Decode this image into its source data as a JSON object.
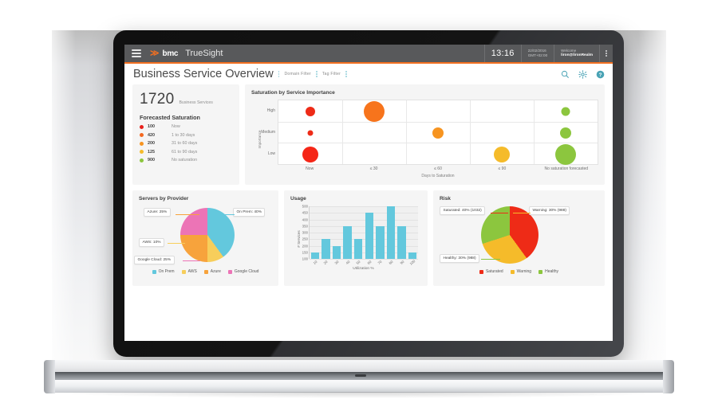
{
  "appbar": {
    "menu_icon": "hamburger-icon",
    "brand_mark": "≫",
    "brand_word": "bmc",
    "product": "TrueSight",
    "time": "13:16",
    "date": "22/02/2016",
    "timezone": "GMT+02:00",
    "welcome_label": "Welcome",
    "user": "liron@lironRealm",
    "more_icon": "kebab-menu-icon"
  },
  "titlebar": {
    "title": "Business Service Overview",
    "domain_filter": "Domain Filter",
    "tag_filter": "Tag Filter",
    "search_icon": "search-icon",
    "settings_icon": "gear-icon",
    "help_icon": "help-icon"
  },
  "kpi": {
    "count": "1720",
    "count_label": "Business Services",
    "section_title": "Forecasted Saturation",
    "rows": [
      {
        "value": "100",
        "label": "Now",
        "color": "#e8211c"
      },
      {
        "value": "420",
        "label": "1 to 30 days",
        "color": "#f4681f"
      },
      {
        "value": "200",
        "label": "31 to 60 days",
        "color": "#f79420"
      },
      {
        "value": "125",
        "label": "61 to 90 days",
        "color": "#f5bb2a"
      },
      {
        "value": "900",
        "label": "No saturation",
        "color": "#8cc63e"
      }
    ]
  },
  "chart_data": [
    {
      "type": "scatter",
      "name": "saturation-by-service-importance",
      "title": "Saturation by Service Importance",
      "xlabel": "Days to Saturation",
      "ylabel": "Importance",
      "categories_x": [
        "Now",
        "≤ 30",
        "≤ 60",
        "≤ 90",
        "No saturation forecasted"
      ],
      "categories_y": [
        "High",
        "Medium",
        "Low"
      ],
      "grid": true,
      "points": [
        {
          "x": "Now",
          "y": "High",
          "size": 12,
          "color": "#ee2b17"
        },
        {
          "x": "Now",
          "y": "Medium",
          "size": 7,
          "color": "#ee2b17"
        },
        {
          "x": "Now",
          "y": "Low",
          "size": 20,
          "color": "#f52617"
        },
        {
          "x": "≤ 30",
          "y": "High",
          "size": 26,
          "color": "#f7741c"
        },
        {
          "x": "≤ 60",
          "y": "Medium",
          "size": 14,
          "color": "#f79420"
        },
        {
          "x": "≤ 90",
          "y": "Low",
          "size": 20,
          "color": "#f5bb2a"
        },
        {
          "x": "No saturation forecasted",
          "y": "High",
          "size": 11,
          "color": "#8cc63e"
        },
        {
          "x": "No saturation forecasted",
          "y": "Medium",
          "size": 14,
          "color": "#8cc63e"
        },
        {
          "x": "No saturation forecasted",
          "y": "Low",
          "size": 26,
          "color": "#8cc63e"
        }
      ]
    },
    {
      "type": "pie",
      "name": "servers-by-provider",
      "title": "Servers by Provider",
      "labels": [
        "On Prem",
        "AWS",
        "Azure",
        "Google Cloud"
      ],
      "values": [
        40,
        10,
        25,
        25
      ],
      "colors": [
        "#63c8dd",
        "#f7ce5b",
        "#f7a33c",
        "#ec74b6"
      ],
      "callouts": [
        "On Prem: 40%",
        "AWS: 10%",
        "Azure: 25%",
        "Google Cloud: 25%"
      ],
      "legend_position": "bottom"
    },
    {
      "type": "bar",
      "name": "usage",
      "title": "Usage",
      "xlabel": "Utilization %",
      "ylabel": "# Services",
      "categories": [
        "10",
        "20",
        "30",
        "40",
        "50",
        "60",
        "70",
        "80",
        "90",
        "100"
      ],
      "values": [
        150,
        250,
        200,
        350,
        250,
        450,
        350,
        500,
        350,
        150
      ],
      "yticks": [
        "500",
        "450",
        "400",
        "350",
        "300",
        "250",
        "200",
        "150",
        "100"
      ],
      "ylim": [
        100,
        500
      ],
      "color": "#63c8dd",
      "grid": true
    },
    {
      "type": "pie",
      "name": "risk",
      "title": "Risk",
      "labels": [
        "Saturated",
        "Warning",
        "Healthy"
      ],
      "values": [
        40,
        30,
        30
      ],
      "counts": [
        1032,
        988,
        988
      ],
      "colors": [
        "#ee2b17",
        "#f5bb2a",
        "#8cc63e"
      ],
      "callouts": [
        "Saturated: 40% (1032)",
        "Warning: 30% (988)",
        "Healthy: 30% (988)"
      ],
      "legend_position": "bottom"
    }
  ]
}
